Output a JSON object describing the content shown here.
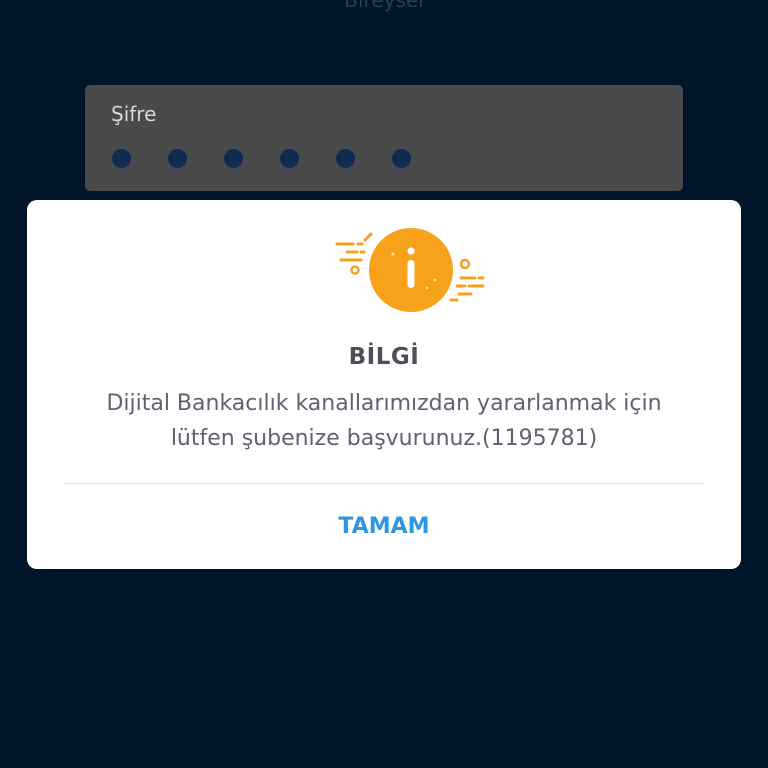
{
  "background": {
    "title": "Bireysel",
    "password": {
      "label": "Şifre",
      "masked_length": 6
    }
  },
  "dialog": {
    "icon": "info-icon",
    "title": "BİLGİ",
    "message_lines": [
      "Dijital Bankacılık kanallarımızdan yararlanmak için",
      "lütfen şubenize başvurunuz.(1195781)"
    ],
    "ok_label": "TAMAM"
  },
  "colors": {
    "background": "#00142a",
    "dialog_bg": "#ffffff",
    "accent_orange": "#f7a21b",
    "button_blue": "#2e95e0",
    "title_text": "#4d4f5b"
  }
}
